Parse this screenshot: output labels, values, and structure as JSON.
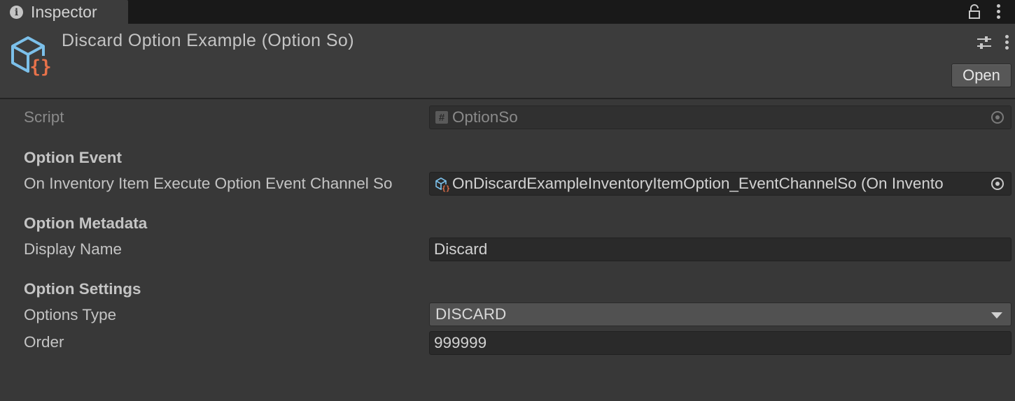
{
  "tab": {
    "label": "Inspector"
  },
  "header": {
    "title": "Discard Option Example (Option So)",
    "open_label": "Open"
  },
  "script_row": {
    "label": "Script",
    "value": "OptionSo"
  },
  "sections": {
    "option_event": "Option Event",
    "option_metadata": "Option Metadata",
    "option_settings": "Option Settings"
  },
  "fields": {
    "event_channel": {
      "label": "On Inventory Item Execute Option Event Channel So",
      "value": "OnDiscardExampleInventoryItemOption_EventChannelSo (On Invento"
    },
    "display_name": {
      "label": "Display Name",
      "value": "Discard"
    },
    "options_type": {
      "label": "Options Type",
      "value": "DISCARD"
    },
    "order": {
      "label": "Order",
      "value": "999999"
    }
  },
  "colors": {
    "background": "#383838",
    "header": "#3c3c3c",
    "tabbar": "#191919",
    "icon_blue": "#7cc0ea",
    "icon_orange": "#e8724a"
  }
}
